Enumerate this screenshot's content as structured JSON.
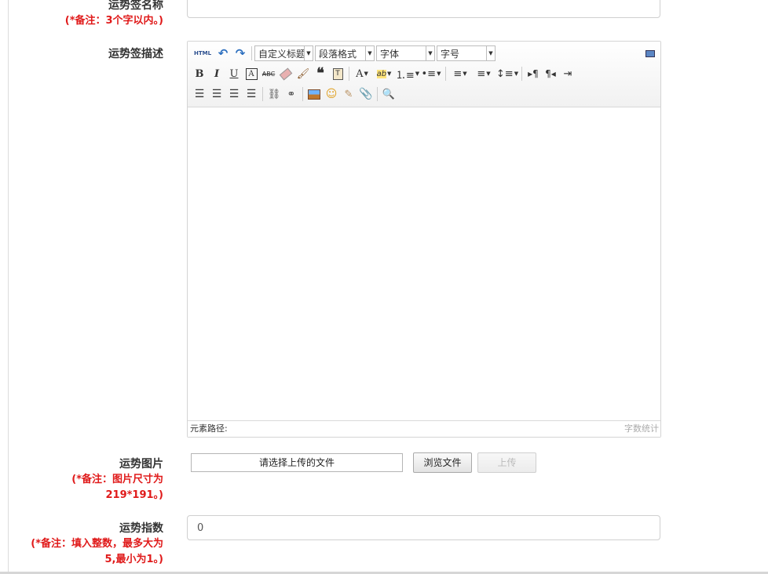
{
  "form": {
    "name_label": "运势签名称",
    "name_note": "(*备注：3个字以内。)",
    "desc_label": "运势签描述",
    "image_label": "运势图片",
    "image_note_1": "(*备注：图片尺寸为",
    "image_note_2": "219*191。)",
    "index_label": "运势指数",
    "index_note_1": "(*备注：填入整数，最多大为",
    "index_note_2": "5,最小为1。)",
    "index_value": "0"
  },
  "editor": {
    "html_label": "HTML",
    "custom_title": "自定义标题",
    "paragraph": "段落格式",
    "font_family": "字体",
    "font_size": "字号",
    "bold": "B",
    "italic": "I",
    "underline": "U",
    "strike": "ABC",
    "text_color": "A",
    "highlight": "ab",
    "quote": "66",
    "element_path": "元素路径:",
    "word_count": "字数统计"
  },
  "upload": {
    "file_placeholder": "请选择上传的文件",
    "browse_label": "浏览文件",
    "upload_label": "上传"
  },
  "colors": {
    "note_red": "#e01a1a",
    "border": "#cfcfcf"
  }
}
